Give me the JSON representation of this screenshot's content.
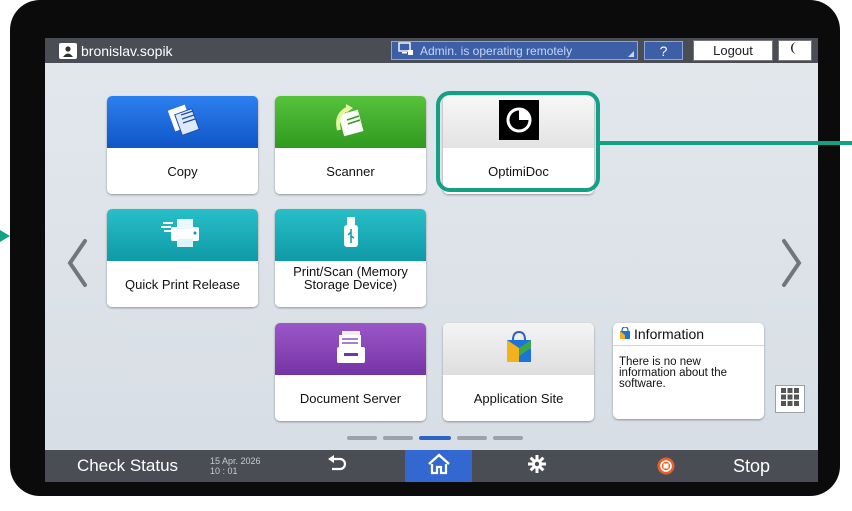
{
  "topbar": {
    "username": "bronislav.sopik",
    "remote_status": "Admin. is operating remotely",
    "help_label": "?",
    "logout_label": "Logout"
  },
  "tiles": {
    "copy": "Copy",
    "scanner": "Scanner",
    "optimidoc": "OptimiDoc",
    "quick_print": "Quick Print Release",
    "print_scan_line1": "Print/Scan (Memory",
    "print_scan_line2": "Storage Device)",
    "document_server": "Document Server",
    "application_site": "Application Site"
  },
  "information": {
    "title": "Information",
    "message": "There is no new information about the software."
  },
  "bottombar": {
    "check_status": "Check Status",
    "date_line1": "15 Apr. 2026",
    "date_line2": "10 : 01",
    "stop": "Stop"
  },
  "pager": {
    "page_count": 5,
    "current_page": 3
  },
  "colors": {
    "copy_tile": "#1569d6",
    "scanner_tile": "#3fae2a",
    "quick_print_tile": "#19a9b4",
    "document_server_tile": "#8a44b8",
    "highlight": "#12a184",
    "home_button": "#3468d1"
  },
  "icons": [
    "user-icon",
    "remote-icon",
    "copy-icon",
    "scanner-icon",
    "optimidoc-icon",
    "printer-icon",
    "usb-icon",
    "document-server-icon",
    "bag-icon",
    "info-icon",
    "grid-icon",
    "back-icon",
    "home-icon",
    "gear-icon",
    "stop-icon",
    "chevron-left-icon",
    "chevron-right-icon",
    "moon-icon"
  ]
}
